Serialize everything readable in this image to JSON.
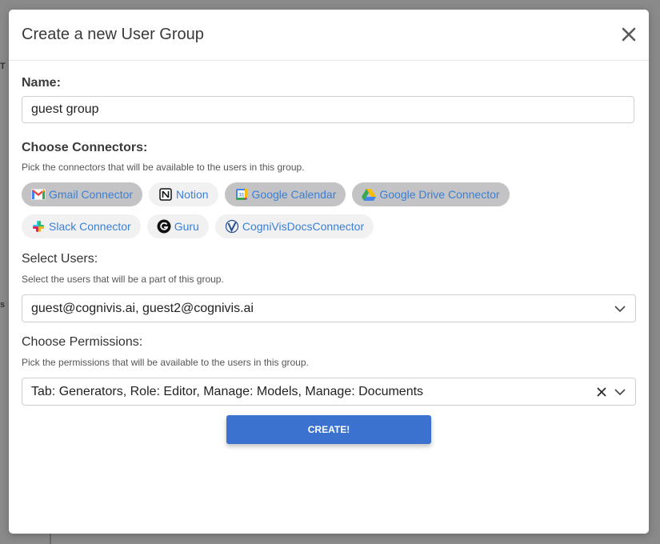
{
  "modal": {
    "title": "Create a new User Group",
    "name_label": "Name:",
    "name_value": "guest group",
    "connectors_label": "Choose Connectors:",
    "connectors_help": "Pick the connectors that will be available to the users in this group.",
    "connectors": [
      {
        "label": "Gmail Connector",
        "icon": "gmail-icon",
        "selected": true
      },
      {
        "label": "Notion",
        "icon": "notion-icon",
        "selected": false
      },
      {
        "label": "Google Calendar",
        "icon": "google-calendar-icon",
        "selected": true
      },
      {
        "label": "Google Drive Connector",
        "icon": "google-drive-icon",
        "selected": true
      },
      {
        "label": "Slack Connector",
        "icon": "slack-icon",
        "selected": false
      },
      {
        "label": "Guru",
        "icon": "guru-icon",
        "selected": false
      },
      {
        "label": "CogniVisDocsConnector",
        "icon": "cognivis-icon",
        "selected": false
      }
    ],
    "users_label": "Select Users:",
    "users_help": "Select the users that will be a part of this group.",
    "users_value": "guest@cognivis.ai, guest2@cognivis.ai",
    "permissions_label": "Choose Permissions:",
    "permissions_help": "Pick the permissions that will be available to the users in this group.",
    "permissions_value": "Tab: Generators, Role: Editor, Manage: Models, Manage: Documents",
    "create_label": "CREATE!"
  },
  "colors": {
    "accent": "#3c72cf",
    "chip_text": "#3b7fd6",
    "chip_selected_bg": "#c3c3c5",
    "chip_bg": "#f1f1f1"
  }
}
